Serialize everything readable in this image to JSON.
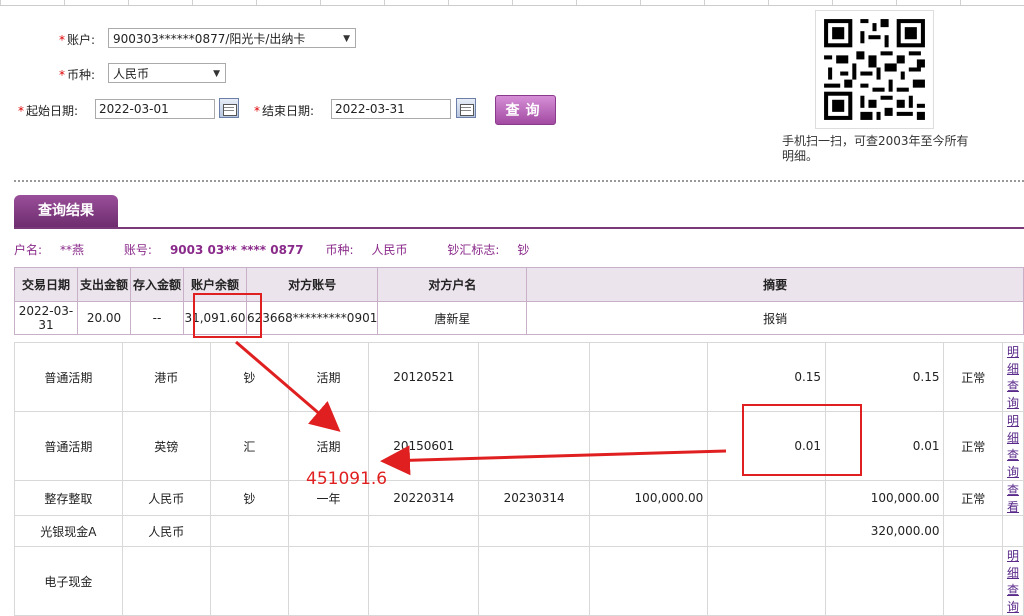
{
  "form": {
    "account_label": "账户:",
    "account_value": "900303******0877/阳光卡/出纳卡",
    "currency_label": "币种:",
    "currency_value": "人民币",
    "start_label": "起始日期:",
    "start_value": "2022-03-01",
    "end_label": "结束日期:",
    "end_value": "2022-03-31",
    "query_button": "查询",
    "required_mark": "*"
  },
  "qr": {
    "note": "手机扫一扫，可查2003年至今所有明细。"
  },
  "result": {
    "tab_label": "查询结果",
    "name_label": "户名:",
    "name_value": "**燕",
    "account_label": "账号:",
    "account_value": "9003 03** **** 0877",
    "currency_label": "币种:",
    "currency_value": "人民币",
    "flag_label": "钞汇标志:",
    "flag_value": "钞",
    "headers": [
      "交易日期",
      "支出金额",
      "存入金额",
      "账户余额",
      "对方账号",
      "对方户名",
      "摘要"
    ],
    "row": [
      "2022-03-31",
      "20.00",
      "--",
      "31,091.60",
      "623668*********0901",
      "唐新星",
      "报销"
    ]
  },
  "deposits": [
    {
      "type": "普通活期",
      "currency": "港币",
      "flag": "钞",
      "term": "活期",
      "start": "20120521",
      "end": "",
      "principal": "",
      "amount": "0.15",
      "balance": "0.15",
      "status": "正常",
      "action": "明细查询"
    },
    {
      "type": "普通活期",
      "currency": "英镑",
      "flag": "汇",
      "term": "活期",
      "start": "20150601",
      "end": "",
      "principal": "",
      "amount": "0.01",
      "balance": "0.01",
      "status": "正常",
      "action": "明细查询"
    },
    {
      "type": "整存整取",
      "currency": "人民币",
      "flag": "钞",
      "term": "一年",
      "start": "20220314",
      "end": "20230314",
      "principal": "100,000.00",
      "amount": "",
      "balance": "100,000.00",
      "status": "正常",
      "action": "查看"
    },
    {
      "type": "光银现金A",
      "currency": "人民币",
      "flag": "",
      "term": "",
      "start": "",
      "end": "",
      "principal": "",
      "amount": "",
      "balance": "320,000.00",
      "status": "",
      "action": ""
    },
    {
      "type": "电子现金",
      "currency": "",
      "flag": "",
      "term": "",
      "start": "",
      "end": "",
      "principal": "",
      "amount": "",
      "balance": "",
      "status": "",
      "action": "明细查询"
    }
  ],
  "annotation": {
    "total": "451091.6",
    "color": "#e02020"
  }
}
